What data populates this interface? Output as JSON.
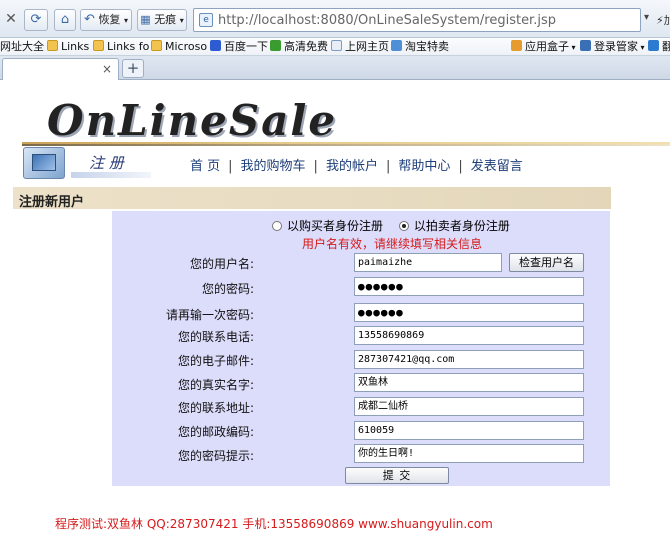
{
  "browser": {
    "back_label": "",
    "restore_label": "恢复",
    "history_label": "无痕",
    "url": "http://localhost:8080/OnLineSaleSystem/register.jsp",
    "extra_label": "加",
    "favorites": [
      {
        "label": "网址大全"
      },
      {
        "label": "Links"
      },
      {
        "label": "Links fo"
      },
      {
        "label": "Microso"
      },
      {
        "label": "百度一下"
      },
      {
        "label": "高清免费"
      },
      {
        "label": "上网主页"
      },
      {
        "label": "淘宝特卖"
      },
      {
        "label": "应用盒子"
      },
      {
        "label": "登录管家"
      },
      {
        "label": "翻"
      }
    ],
    "tab_close": "×",
    "new_tab": "+"
  },
  "page": {
    "logo_text": "OnLineSale",
    "register_graphic_text": "注 册",
    "nav": [
      {
        "label": "首 页"
      },
      {
        "label": "我的购物车"
      },
      {
        "label": "我的帐户"
      },
      {
        "label": "帮助中心"
      },
      {
        "label": "发表留言"
      }
    ],
    "nav_separator": "|",
    "section_title": "注册新用户",
    "radio_buyer": "以购买者身份注册",
    "radio_seller": "以拍卖者身份注册",
    "notice": "用户名有效，请继续填写相关信息",
    "fields": [
      {
        "label": "您的用户名:",
        "value": "paimaizhe"
      },
      {
        "label": "您的密码:",
        "value": "●●●●●●"
      },
      {
        "label": "请再输一次密码:",
        "value": "●●●●●●"
      },
      {
        "label": "您的联系电话:",
        "value": "13558690869"
      },
      {
        "label": "您的电子邮件:",
        "value": "287307421@qq.com"
      },
      {
        "label": "您的真实名字:",
        "value": "双鱼林"
      },
      {
        "label": "您的联系地址:",
        "value": "成都二仙桥"
      },
      {
        "label": "您的邮政编码:",
        "value": "610059"
      },
      {
        "label": "您的密码提示:",
        "value": "你的生日啊!"
      }
    ],
    "check_button": "检查用户名",
    "submit_button": "提  交",
    "footer": "程序测试:双鱼林 QQ:287307421 手机:13558690869 www.shuangyulin.com"
  },
  "colors": {
    "panel": "#dcdcfb",
    "section_bar": "#ede2c9",
    "notice": "#d71a1a",
    "nav_link": "#1d3f7a"
  }
}
